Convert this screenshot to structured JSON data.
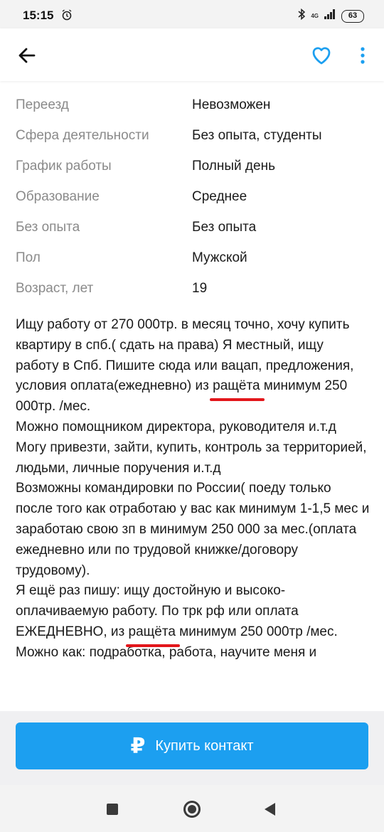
{
  "status_bar": {
    "time": "15:15",
    "network": "4G",
    "battery": "63"
  },
  "icons": {
    "back": "arrow-left-icon",
    "favorite": "heart-outline-icon",
    "more": "more-vert-icon",
    "buy": "ruble-icon"
  },
  "colors": {
    "accent": "#1c9ff0",
    "underline": "#e3161b"
  },
  "properties": [
    {
      "key": "Переезд",
      "value": "Невозможен"
    },
    {
      "key": "Сфера деятельности",
      "value": "Без опыта, студенты"
    },
    {
      "key": "График работы",
      "value": "Полный день"
    },
    {
      "key": "Образование",
      "value": "Среднее"
    },
    {
      "key": "Без опыта",
      "value": "Без опыта"
    },
    {
      "key": "Пол",
      "value": "Мужской"
    },
    {
      "key": "Возраст, лет",
      "value": "19"
    }
  ],
  "description": {
    "p1_a": "Ищу работу от 270 000тр. в месяц точно, хочу купить квартиру в спб.( сдать на права) Я местный, ищу работу в Спб. Пишите сюда или вацап, предложения, условия оплата(ежедневно) из ",
    "p1_hl": "ращёта",
    "p1_b": " минимум 250 000тр. /мес.",
    "p2": "Можно помощником директора, руководителя и.т.д",
    "p3": "Могу привезти, зайти, купить, контроль за территорией, людьми, личные поручения и.т.д",
    "p4": "Возможны командировки по России( поеду только после того как отработаю  у вас как минимум  1-1,5 мес и заработаю свою зп в минимум  250 000 за мес.(оплата ежедневно или по трудовой книжке/договору трудовому).",
    "p5_a": "Я ещё раз пишу: ищу достойную и высоко-оплачиваемую работу. По трк рф или оплата ЕЖЕДНЕВНО, из ",
    "p5_hl": "ращёта",
    "p5_b": " минимум 250 000тр /мес.",
    "p6": "Можно как: подработка, работа, научите меня и"
  },
  "buy_button": {
    "label": "Купить контакт"
  }
}
